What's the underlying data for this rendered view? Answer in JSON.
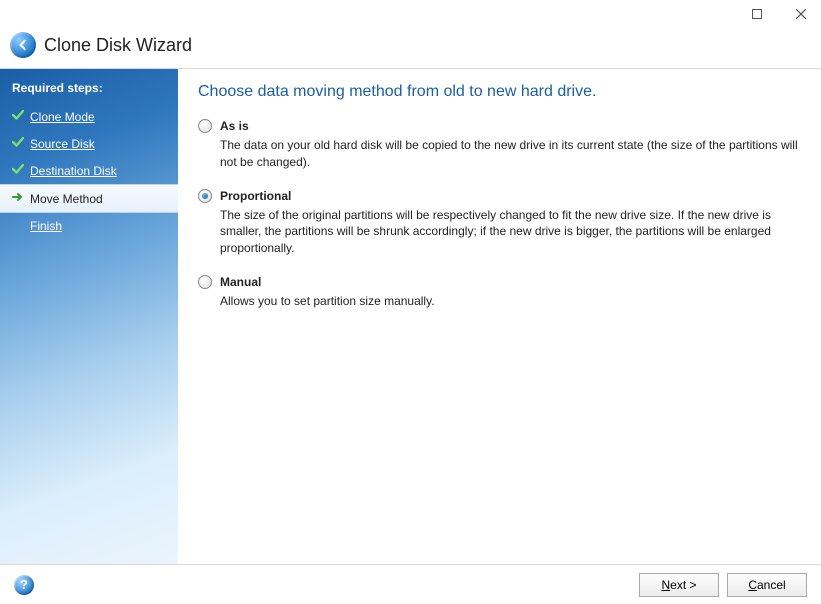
{
  "window": {
    "title": "Clone Disk Wizard"
  },
  "sidebar": {
    "header": "Required steps:",
    "steps": [
      {
        "label": "Clone Mode",
        "state": "done"
      },
      {
        "label": "Source Disk",
        "state": "done"
      },
      {
        "label": "Destination Disk",
        "state": "done"
      },
      {
        "label": "Move Method",
        "state": "active"
      },
      {
        "label": "Finish",
        "state": "pending"
      }
    ]
  },
  "content": {
    "heading": "Choose data moving method from old to new hard drive.",
    "options": [
      {
        "key": "asis",
        "label": "As is",
        "selected": false,
        "description": "The data on your old hard disk will be copied to the new drive in its current state (the size of the partitions will not be changed)."
      },
      {
        "key": "proportional",
        "label": "Proportional",
        "selected": true,
        "description": "The size of the original partitions will be respectively changed to fit the new drive size. If the new drive is smaller, the partitions will be shrunk accordingly; if the new drive is bigger, the partitions will be enlarged proportionally."
      },
      {
        "key": "manual",
        "label": "Manual",
        "selected": false,
        "description": "Allows you to set partition size manually."
      }
    ]
  },
  "footer": {
    "next_prefix": "N",
    "next_rest": "ext >",
    "cancel_prefix": "C",
    "cancel_rest": "ancel",
    "help": "?"
  }
}
